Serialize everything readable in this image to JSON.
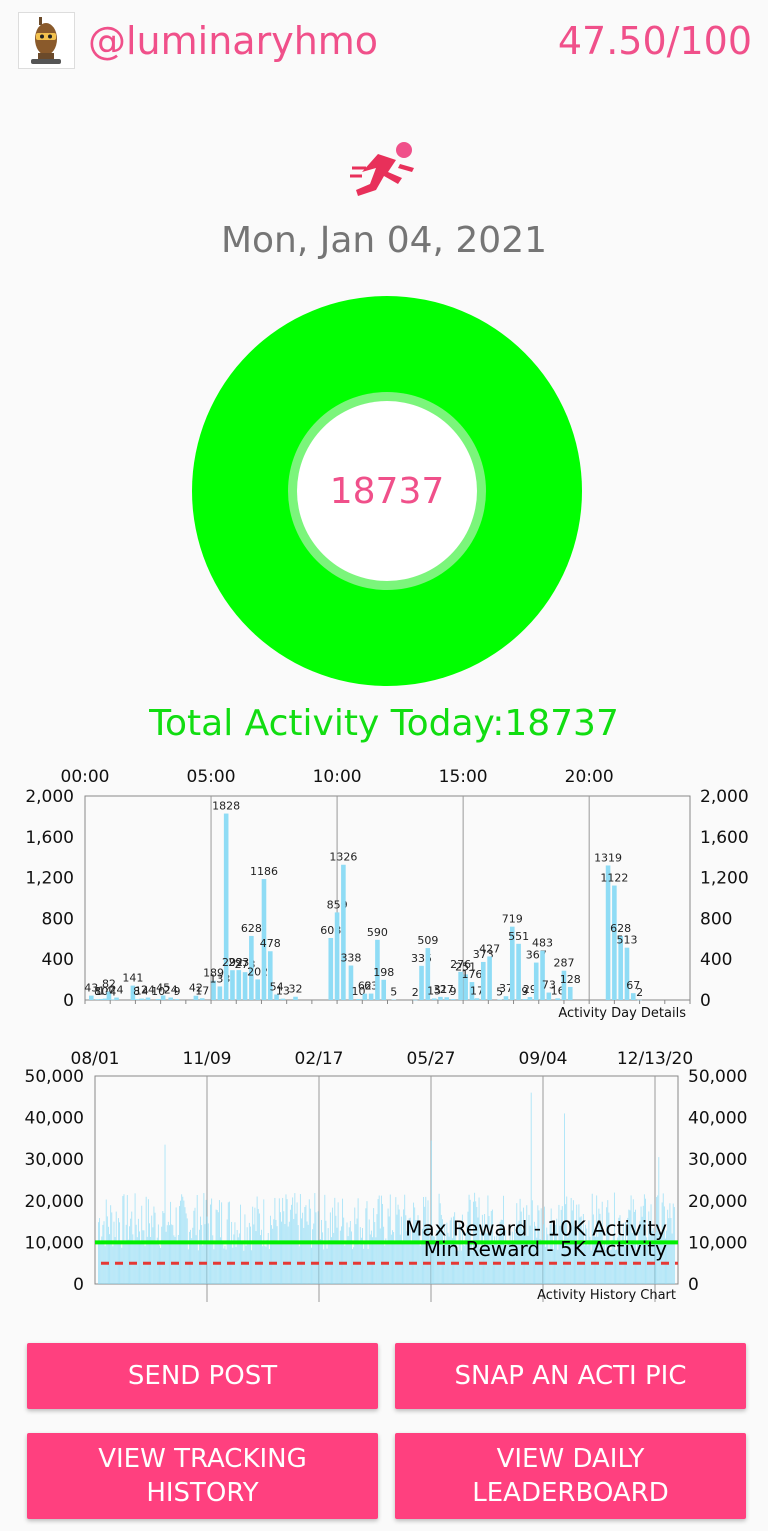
{
  "header": {
    "username": "@luminaryhmo",
    "score": "47.50/100",
    "avatar_icon": "robot-avatar-icon"
  },
  "activity_icon": "running-person-icon",
  "date": "Mon, Jan 04, 2021",
  "donut": {
    "value": "18737",
    "fill_fraction": 1.0
  },
  "total_label": "Total Activity Today:18737",
  "colors": {
    "accent": "#f0508a",
    "button": "#ff407f",
    "ring": "#00ff00",
    "bar": "#8fdcf5",
    "total_text": "#11dd11",
    "min_line": "#e53935"
  },
  "chart_data": [
    {
      "type": "bar",
      "title": "Activity Day Details",
      "x_ticks": [
        "00:00",
        "05:00",
        "10:00",
        "15:00",
        "20:00"
      ],
      "y_ticks": [
        "0",
        "400",
        "800",
        "1,200",
        "1,600",
        "2,000"
      ],
      "ylim": [
        0,
        2000
      ],
      "xlim_hours": [
        0,
        24
      ],
      "grid": true,
      "bars": [
        {
          "h": 0.25,
          "v": 43,
          "label": "43"
        },
        {
          "h": 0.5,
          "v": 8,
          "label": "8"
        },
        {
          "h": 0.65,
          "v": 10,
          "label": "10"
        },
        {
          "h": 0.8,
          "v": 14,
          "label": "14"
        },
        {
          "h": 0.95,
          "v": 82,
          "label": "82"
        },
        {
          "h": 1.1,
          "v": 4,
          "label": "4"
        },
        {
          "h": 1.25,
          "v": 24,
          "label": "24"
        },
        {
          "h": 1.9,
          "v": 141,
          "label": "141"
        },
        {
          "h": 2.05,
          "v": 8,
          "label": "8"
        },
        {
          "h": 2.25,
          "v": 14,
          "label": "14"
        },
        {
          "h": 2.5,
          "v": 24,
          "label": "24"
        },
        {
          "h": 2.9,
          "v": 10,
          "label": "10"
        },
        {
          "h": 3.1,
          "v": 45,
          "label": "45"
        },
        {
          "h": 3.4,
          "v": 24,
          "label": "24"
        },
        {
          "h": 3.65,
          "v": 9,
          "label": "9"
        },
        {
          "h": 4.4,
          "v": 42,
          "label": "42"
        },
        {
          "h": 4.65,
          "v": 17,
          "label": "17"
        },
        {
          "h": 5.1,
          "v": 189,
          "label": "189"
        },
        {
          "h": 5.35,
          "v": 133,
          "label": "133"
        },
        {
          "h": 5.6,
          "v": 1828,
          "label": "1828"
        },
        {
          "h": 5.85,
          "v": 292,
          "label": "292"
        },
        {
          "h": 6.1,
          "v": 293,
          "label": "293"
        },
        {
          "h": 6.35,
          "v": 273,
          "label": "273"
        },
        {
          "h": 6.6,
          "v": 628,
          "label": "628"
        },
        {
          "h": 6.85,
          "v": 202,
          "label": "202"
        },
        {
          "h": 7.1,
          "v": 1186,
          "label": "1186"
        },
        {
          "h": 7.35,
          "v": 478,
          "label": "478"
        },
        {
          "h": 7.6,
          "v": 54,
          "label": "54"
        },
        {
          "h": 7.85,
          "v": 13,
          "label": "13"
        },
        {
          "h": 8.35,
          "v": 32,
          "label": "32"
        },
        {
          "h": 9.75,
          "v": 608,
          "label": "608"
        },
        {
          "h": 10.0,
          "v": 859,
          "label": "859"
        },
        {
          "h": 10.25,
          "v": 1326,
          "label": "1326"
        },
        {
          "h": 10.55,
          "v": 338,
          "label": "338"
        },
        {
          "h": 10.85,
          "v": 10,
          "label": "10"
        },
        {
          "h": 11.1,
          "v": 62,
          "label": "62"
        },
        {
          "h": 11.35,
          "v": 63,
          "label": "63"
        },
        {
          "h": 11.6,
          "v": 590,
          "label": "590"
        },
        {
          "h": 11.85,
          "v": 198,
          "label": "198"
        },
        {
          "h": 12.25,
          "v": 5,
          "label": "5"
        },
        {
          "h": 13.1,
          "v": 2,
          "label": "2"
        },
        {
          "h": 13.35,
          "v": 335,
          "label": "335"
        },
        {
          "h": 13.6,
          "v": 509,
          "label": "509"
        },
        {
          "h": 13.85,
          "v": 15,
          "label": "15"
        },
        {
          "h": 14.1,
          "v": 31,
          "label": "31"
        },
        {
          "h": 14.35,
          "v": 27,
          "label": "27"
        },
        {
          "h": 14.6,
          "v": 9,
          "label": "9"
        },
        {
          "h": 14.9,
          "v": 276,
          "label": "276"
        },
        {
          "h": 15.1,
          "v": 251,
          "label": "251"
        },
        {
          "h": 15.35,
          "v": 176,
          "label": "176"
        },
        {
          "h": 15.55,
          "v": 17,
          "label": "17"
        },
        {
          "h": 15.8,
          "v": 373,
          "label": "373"
        },
        {
          "h": 16.05,
          "v": 427,
          "label": "427"
        },
        {
          "h": 16.45,
          "v": 5,
          "label": "5"
        },
        {
          "h": 16.7,
          "v": 37,
          "label": "37"
        },
        {
          "h": 16.95,
          "v": 719,
          "label": "719"
        },
        {
          "h": 17.2,
          "v": 551,
          "label": "551"
        },
        {
          "h": 17.45,
          "v": 9,
          "label": "9"
        },
        {
          "h": 17.65,
          "v": 29,
          "label": "29"
        },
        {
          "h": 17.9,
          "v": 367,
          "label": "367"
        },
        {
          "h": 18.15,
          "v": 483,
          "label": "483"
        },
        {
          "h": 18.4,
          "v": 73,
          "label": "73"
        },
        {
          "h": 18.75,
          "v": 16,
          "label": "16"
        },
        {
          "h": 19.0,
          "v": 287,
          "label": "287"
        },
        {
          "h": 19.25,
          "v": 128,
          "label": "128"
        },
        {
          "h": 20.75,
          "v": 1319,
          "label": "1319"
        },
        {
          "h": 21.0,
          "v": 1122,
          "label": "1122"
        },
        {
          "h": 21.25,
          "v": 628,
          "label": "628"
        },
        {
          "h": 21.5,
          "v": 513,
          "label": "513"
        },
        {
          "h": 21.75,
          "v": 67,
          "label": "67"
        },
        {
          "h": 22.0,
          "v": 2,
          "label": "2"
        }
      ]
    },
    {
      "type": "bar",
      "title": "Activity History Chart",
      "x_ticks": [
        "08/01",
        "11/09",
        "02/17",
        "05/27",
        "09/04",
        "12/13/20"
      ],
      "y_ticks": [
        "0",
        "10,000",
        "20,000",
        "30,000",
        "40,000",
        "50,000"
      ],
      "ylim": [
        0,
        50000
      ],
      "grid": true,
      "reference_lines": [
        {
          "name": "Max Reward - 10K Activity",
          "value": 10000,
          "style": "solid"
        },
        {
          "name": "Min Reward - 5K Activity",
          "value": 5000,
          "style": "dashed"
        }
      ],
      "typical_daily_range": [
        8000,
        22000
      ],
      "peak_values": [
        33500,
        41000,
        46000,
        34500,
        30500
      ]
    }
  ],
  "buttons": {
    "send_post": "SEND POST",
    "snap_pic": "SNAP AN ACTI PIC",
    "view_history": "VIEW TRACKING\nHISTORY",
    "view_leaderboard": "VIEW DAILY\nLEADERBOARD"
  }
}
